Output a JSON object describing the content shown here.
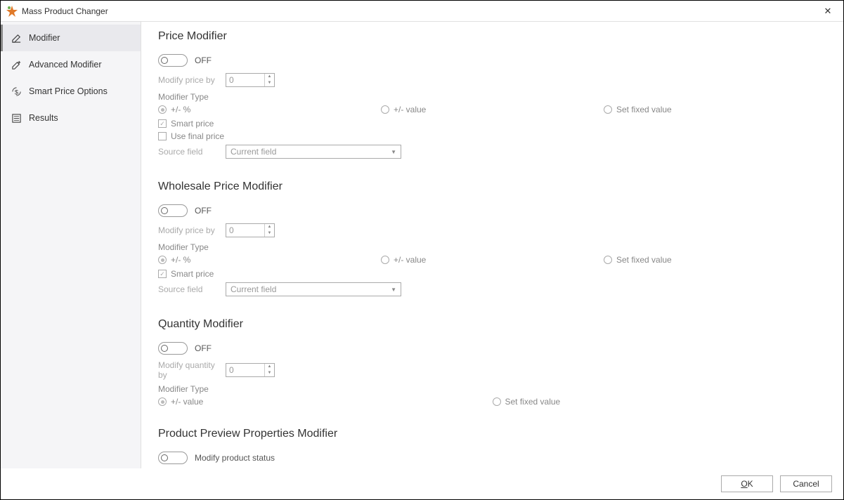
{
  "titlebar": {
    "title": "Mass Product Changer"
  },
  "sidebar": {
    "items": [
      {
        "label": "Modifier"
      },
      {
        "label": "Advanced Modifier"
      },
      {
        "label": "Smart Price Options"
      },
      {
        "label": "Results"
      }
    ]
  },
  "sections": {
    "price": {
      "heading": "Price Modifier",
      "toggle_label": "OFF",
      "modify_label": "Modify price by",
      "modify_value": "0",
      "type_label": "Modifier Type",
      "opts": {
        "a": "+/- %",
        "b": "+/- value",
        "c": "Set fixed value"
      },
      "smart": "Smart price",
      "final": "Use final price",
      "source_label": "Source field",
      "source_value": "Current field"
    },
    "wholesale": {
      "heading": "Wholesale Price Modifier",
      "toggle_label": "OFF",
      "modify_label": "Modify price by",
      "modify_value": "0",
      "type_label": "Modifier Type",
      "opts": {
        "a": "+/- %",
        "b": "+/- value",
        "c": "Set fixed value"
      },
      "smart": "Smart price",
      "source_label": "Source field",
      "source_value": "Current field"
    },
    "quantity": {
      "heading": "Quantity Modifier",
      "toggle_label": "OFF",
      "modify_label": "Modify quantity by",
      "modify_value": "0",
      "type_label": "Modifier Type",
      "opts": {
        "a": "+/- value",
        "b": "Set fixed value"
      }
    },
    "preview": {
      "heading": "Product Preview Properties Modifier",
      "toggle_label": "Modify product status"
    }
  },
  "footer": {
    "ok": "OK",
    "cancel": "Cancel"
  }
}
